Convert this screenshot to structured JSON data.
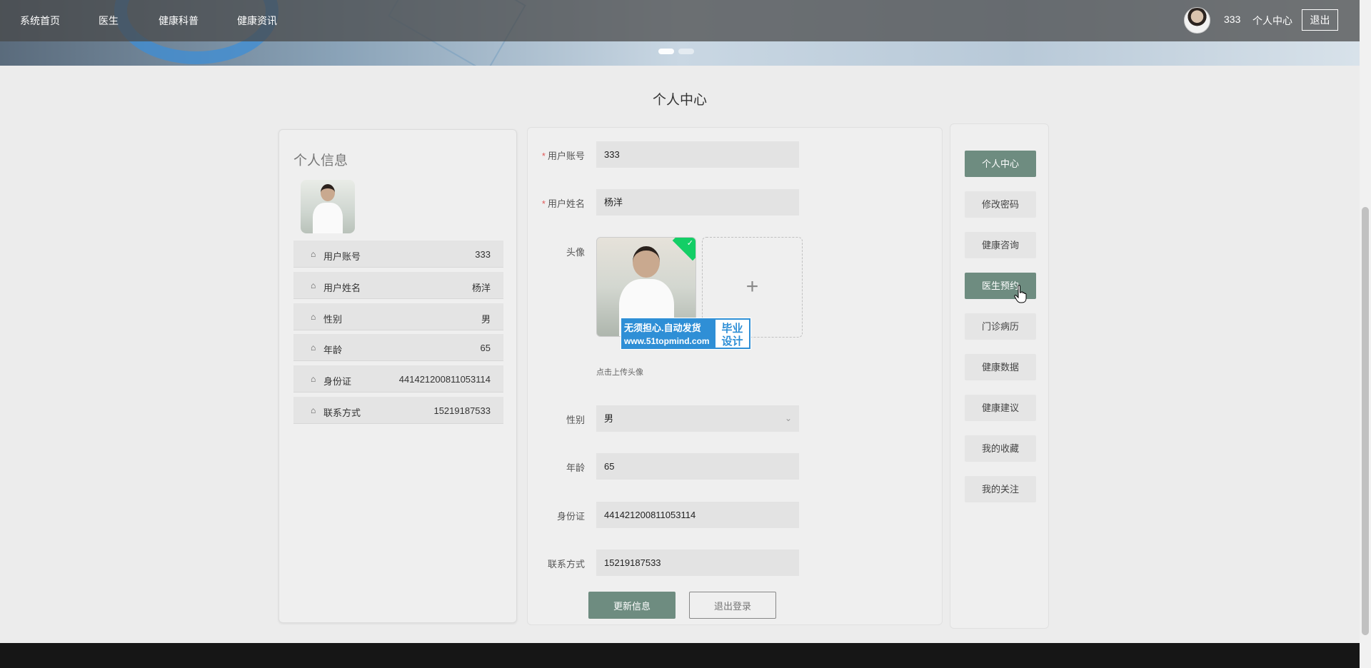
{
  "nav": {
    "items": [
      "系统首页",
      "医生",
      "健康科普",
      "健康资讯"
    ],
    "username": "333",
    "center": "个人中心",
    "logout": "退出"
  },
  "page_title": "个人中心",
  "info": {
    "title": "个人信息",
    "rows": [
      {
        "label": "用户账号",
        "value": "333"
      },
      {
        "label": "用户姓名",
        "value": "杨洋"
      },
      {
        "label": "性别",
        "value": "男"
      },
      {
        "label": "年龄",
        "value": "65"
      },
      {
        "label": "身份证",
        "value": "441421200811053114"
      },
      {
        "label": "联系方式",
        "value": "15219187533"
      }
    ]
  },
  "form": {
    "account_label": "用户账号",
    "account_value": "333",
    "name_label": "用户姓名",
    "name_value": "杨洋",
    "avatar_label": "头像",
    "upload_plus": "+",
    "upload_hint": "点击上传头像",
    "gender_label": "性别",
    "gender_value": "男",
    "age_label": "年龄",
    "age_value": "65",
    "idcard_label": "身份证",
    "idcard_value": "441421200811053114",
    "phone_label": "联系方式",
    "phone_value": "15219187533",
    "update_btn": "更新信息",
    "logout_btn": "退出登录"
  },
  "watermark": {
    "line1": "无须担心.自动发货",
    "url": "www.51topmind.com",
    "right1": "毕业",
    "right2": "设计"
  },
  "menu": [
    "个人中心",
    "修改密码",
    "健康咨询",
    "医生预约",
    "门诊病历",
    "健康数据",
    "健康建议",
    "我的收藏",
    "我的关注"
  ],
  "colors": {
    "accent": "#6e8c80",
    "required": "#e05a5a",
    "footer": "#161616"
  }
}
